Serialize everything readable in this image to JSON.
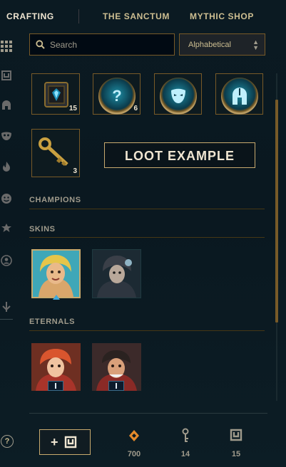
{
  "nav": {
    "tabs": [
      {
        "label": "CRAFTING",
        "active": true
      },
      {
        "label": "THE SANCTUM",
        "active": false
      },
      {
        "label": "MYTHIC SHOP",
        "active": false
      }
    ]
  },
  "rail": {
    "icons": [
      "grid-icon",
      "chest-icon",
      "helmet-icon",
      "mask-icon",
      "flame-icon",
      "emote-icon",
      "ward-icon",
      "profile-icon",
      "disenchant-all-icon"
    ]
  },
  "search": {
    "placeholder": "Search",
    "value": ""
  },
  "sort": {
    "selected": "Alphabetical"
  },
  "loot_tiles": [
    {
      "name": "hextech-chest-icon",
      "count": "15"
    },
    {
      "name": "mystery-orb-icon",
      "count": "6",
      "glyph": "?"
    },
    {
      "name": "mask-orb-icon",
      "count": ""
    },
    {
      "name": "helmet-orb-icon",
      "count": ""
    }
  ],
  "key_tile": {
    "name": "key-fragment-icon",
    "count": "3"
  },
  "loot_example_label": "LOOT EXAMPLE",
  "sections": {
    "champions": "CHAMPIONS",
    "skins": "SKINS",
    "eternals": "ETERNALS"
  },
  "footer": {
    "help": "?",
    "add_label": "+",
    "currencies": [
      {
        "name": "orange-essence-icon",
        "value": "700",
        "color": "#e58a2b"
      },
      {
        "name": "key-icon",
        "value": "14",
        "color": "#a09b8c"
      },
      {
        "name": "chest-icon",
        "value": "15",
        "color": "#a09b8c"
      }
    ]
  },
  "colors": {
    "gold": "#c8aa6e",
    "dark_gold": "#785a28",
    "bg": "#0a1820",
    "text": "#f0e6d2"
  }
}
